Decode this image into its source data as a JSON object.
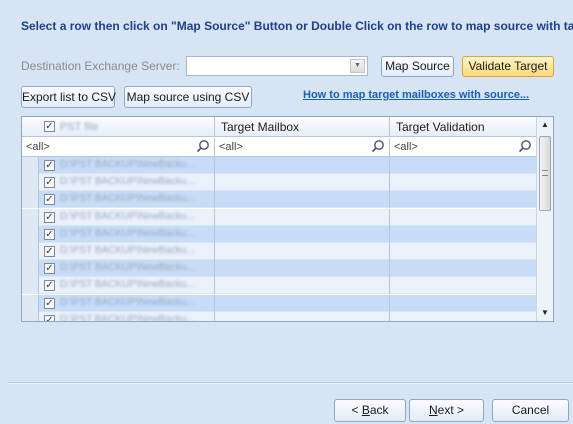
{
  "instruction": "Select a row then click on \"Map Source\" Button or Double Click on the row to map source with target.",
  "destination": {
    "label": "Destination Exchange Server:",
    "value": ""
  },
  "buttons": {
    "map_source": "Map Source",
    "validate_target": "Validate Target",
    "export_csv": "Export list to CSV",
    "map_csv": "Map source using CSV"
  },
  "help_link": "How to map target mailboxes with source...",
  "grid": {
    "columns": [
      "PST file",
      "Target Mailbox",
      "Target Validation"
    ],
    "filter_placeholder": "<all>",
    "rows": [
      "D:\\PST BACKUP\\NewBacku...",
      "D:\\PST BACKUP\\NewBacku...",
      "D:\\PST BACKUP\\NewBacku...",
      "D:\\PST BACKUP\\NewBacku...",
      "D:\\PST BACKUP\\NewBacku...",
      "D:\\PST BACKUP\\NewBacku...",
      "D:\\PST BACKUP\\NewBacku...",
      "D:\\PST BACKUP\\NewBacku...",
      "D:\\PST BACKUP\\NewBacku...",
      "D:\\PST BACKUP\\NewBacku..."
    ]
  },
  "footer": {
    "back": {
      "prefix": "< ",
      "key": "B",
      "rest": "ack"
    },
    "next": {
      "key": "N",
      "rest": "ext >"
    },
    "cancel": "Cancel"
  },
  "colors": {
    "background": "#d6e4f4",
    "accent": "#1e3f8a",
    "link": "#1a5fb4",
    "row_alt": "#c7dcf6"
  },
  "icons": [
    "checkbox-icon",
    "search-icon",
    "dropdown-arrow-icon",
    "scroll-up-icon",
    "scroll-down-icon"
  ]
}
